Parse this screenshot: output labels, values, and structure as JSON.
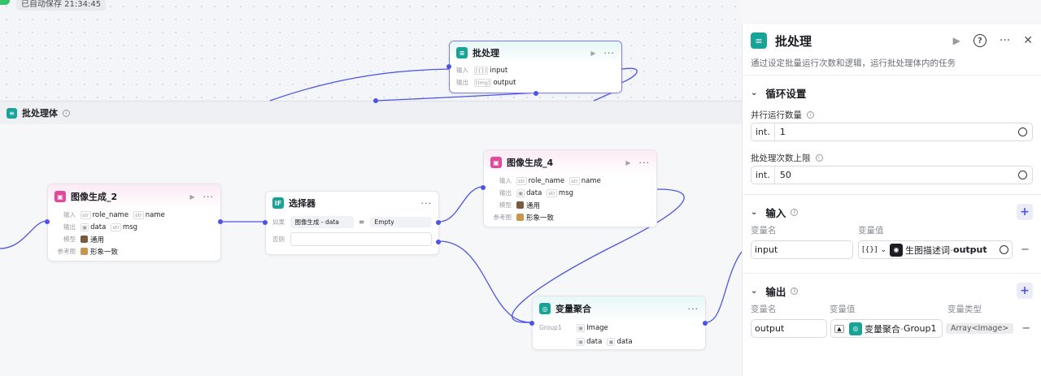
{
  "status": {
    "autosave": "已自动保存 21:34:45"
  },
  "group": {
    "title": "批处理体"
  },
  "batch_node": {
    "title": "批处理",
    "input_label": "输入",
    "input_value": "input",
    "input_type": "[{}]",
    "output_label": "输出",
    "output_value": "output",
    "output_type": "[Img]"
  },
  "img2": {
    "title": "图像生成_2",
    "in_label": "输入",
    "in1_type": "str",
    "in1": "role_name",
    "in2_type": "str",
    "in2": "name",
    "out_label": "输出",
    "out1": "data",
    "out2_type": "str",
    "out2": "msg",
    "model_label": "模型",
    "model": "通用",
    "ref_label": "参考图",
    "ref": "形象一致"
  },
  "selector": {
    "title": "选择器",
    "if_label": "如果",
    "if_left": "图像生成 - data",
    "op": "=",
    "if_right": "Empty",
    "else_label": "否则"
  },
  "img4": {
    "title": "图像生成_4",
    "in_label": "输入",
    "in1_type": "str",
    "in1": "role_name",
    "in2_type": "str",
    "in2": "name",
    "out_label": "输出",
    "out1": "data",
    "out2_type": "str",
    "out2": "msg",
    "model_label": "模型",
    "model": "通用",
    "ref_label": "参考图",
    "ref": "形象一致"
  },
  "merge": {
    "title": "变量聚合",
    "group_label": "Group1",
    "g1": "Image",
    "g2": "data",
    "g3": "data"
  },
  "panel": {
    "title": "批处理",
    "desc": "通过设定批量运行次数和逻辑，运行批处理体内的任务",
    "loop_title": "循环设置",
    "parallel_label": "并行运行数量",
    "parallel_prefix": "int.",
    "parallel_value": "1",
    "limit_label": "批处理次数上限",
    "limit_prefix": "int.",
    "limit_value": "50",
    "input_title": "输入",
    "col_name": "变量名",
    "col_value": "变量值",
    "col_type": "变量类型",
    "input_name": "input",
    "input_type_glyph": "[{}]",
    "input_ref_node": "生图描述词",
    "input_ref_sep": " - ",
    "input_ref_var": "output",
    "output_title": "输出",
    "output_name": "output",
    "output_ref_node": "变量聚合",
    "output_ref_sep": " - ",
    "output_ref_var": "Group1",
    "output_type": "Array<Image>"
  },
  "colors": {
    "accent": "#4d53e8",
    "teal": "#18a397",
    "pink": "#e3489a"
  }
}
